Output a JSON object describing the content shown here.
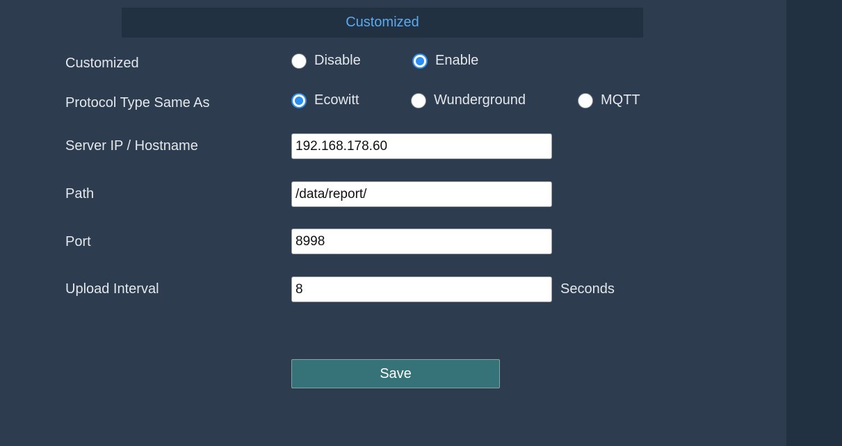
{
  "section": {
    "title": "Customized"
  },
  "fields": {
    "customized": {
      "label": "Customized",
      "options": [
        {
          "label": "Disable",
          "checked": false
        },
        {
          "label": "Enable",
          "checked": true
        }
      ]
    },
    "protocol": {
      "label": "Protocol Type Same As",
      "options": [
        {
          "label": "Ecowitt",
          "checked": true
        },
        {
          "label": "Wunderground",
          "checked": false
        },
        {
          "label": "MQTT",
          "checked": false
        }
      ]
    },
    "server": {
      "label": "Server IP / Hostname",
      "value": "192.168.178.60"
    },
    "path": {
      "label": "Path",
      "value": "/data/report/"
    },
    "port": {
      "label": "Port",
      "value": "8998"
    },
    "interval": {
      "label": "Upload Interval",
      "value": "8",
      "unit": "Seconds"
    }
  },
  "save_label": "Save",
  "colors": {
    "background": "#2d3c4e",
    "header_bg": "#223142",
    "header_text": "#5aaaf0",
    "radio_accent": "#2a8ef3",
    "save_button": "#367378"
  }
}
